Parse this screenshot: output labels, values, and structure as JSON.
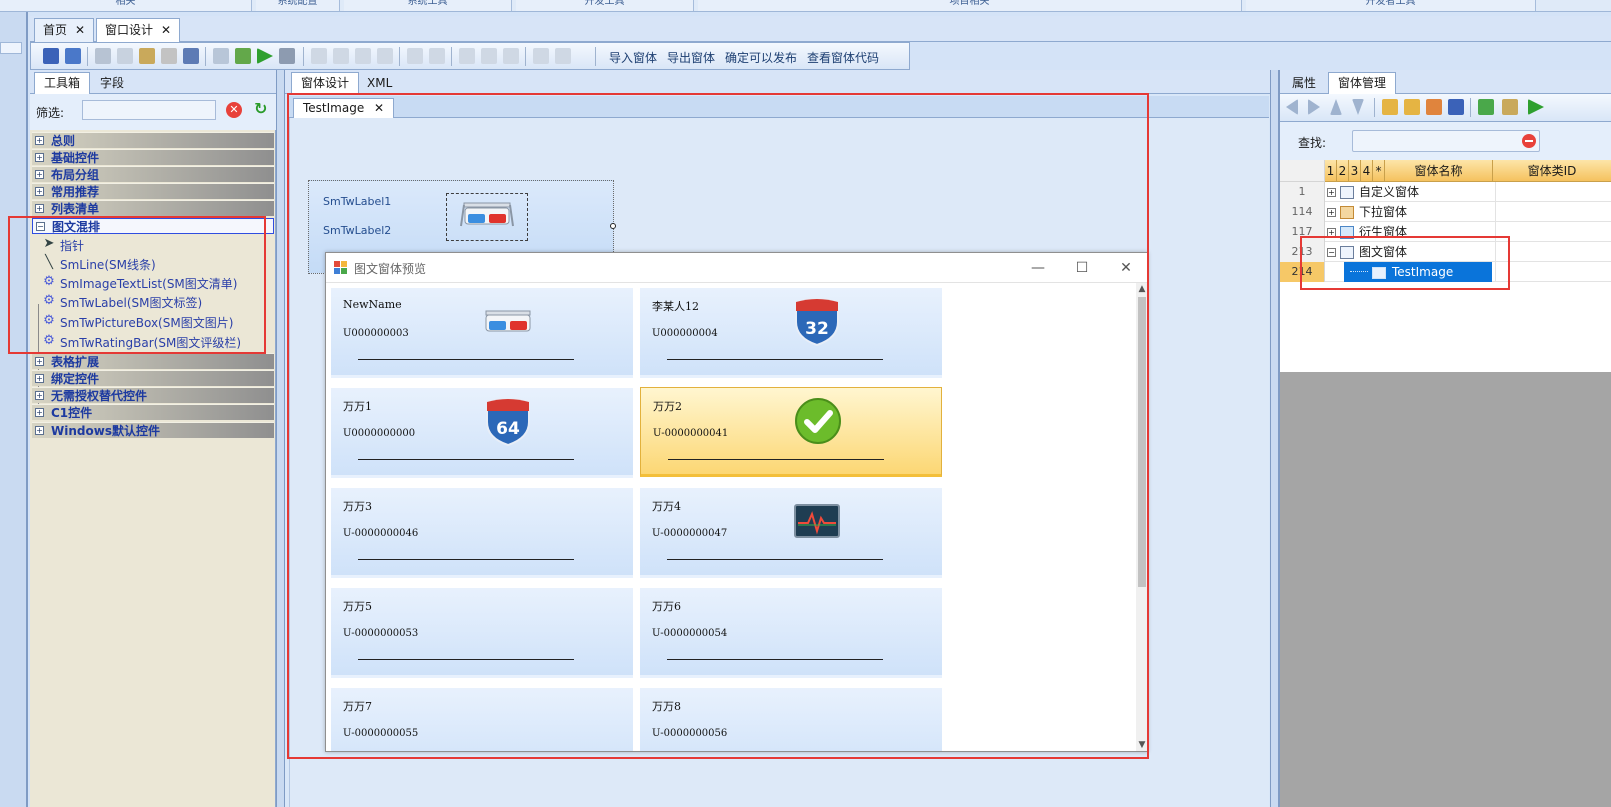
{
  "ribbon": {
    "groups": [
      "相关",
      "系统配置",
      "系统工具",
      "开发工具",
      "项目相关",
      "开发者工具"
    ]
  },
  "doc_tabs": [
    {
      "label": "首页",
      "close": "✕"
    },
    {
      "label": "窗口设计",
      "close": "✕"
    }
  ],
  "toolbar": {
    "import_label": "导入窗体",
    "export_label": "导出窗体",
    "publish_label": "确定可以发布",
    "view_code_label": "查看窗体代码"
  },
  "toolbox": {
    "tabs": [
      "工具箱",
      "字段"
    ],
    "filter_label": "筛选:",
    "filter_value": "",
    "clear_glyph": "✕",
    "refresh_glyph": "↻",
    "categories_top": [
      "总则",
      "基础控件",
      "布局分组",
      "常用推荐",
      "列表清单"
    ],
    "open_category": "图文混排",
    "items": [
      {
        "label": "指针",
        "icon": "pointer-icon",
        "glyph": "➤"
      },
      {
        "label": "SmLine(SM线条)",
        "icon": "line-icon",
        "glyph": "╲"
      },
      {
        "label": "SmImageTextList(SM图文清单)",
        "icon": "gear-icon",
        "glyph": "⚙"
      },
      {
        "label": "SmTwLabel(SM图文标签)",
        "icon": "gear-icon",
        "glyph": "⚙"
      },
      {
        "label": "SmTwPictureBox(SM图文图片)",
        "icon": "gear-icon",
        "glyph": "⚙"
      },
      {
        "label": "SmTwRatingBar(SM图文评级栏)",
        "icon": "gear-icon",
        "glyph": "⚙"
      }
    ],
    "categories_bottom": [
      "表格扩展",
      "绑定控件",
      "无需授权替代控件",
      "C1控件",
      "Windows默认控件"
    ]
  },
  "designer": {
    "tabs": [
      "窗体设计",
      "XML"
    ],
    "canvas_tab": "TestImage",
    "canvas_tab_close": "✕",
    "label1": "SmTwLabel1",
    "label2": "SmTwLabel2"
  },
  "preview": {
    "title": "图文窗体预览",
    "minimize": "—",
    "maximize": "☐",
    "close": "✕",
    "scroll_up": "▲",
    "scroll_down": "▼",
    "cards": [
      {
        "name": "NewName",
        "code": "U000000003",
        "icon": "3d-glasses-icon"
      },
      {
        "name": "李某人12",
        "code": "U000000004",
        "icon": "interstate-32-icon",
        "shield": "32"
      },
      {
        "name": "万万1",
        "code": "U0000000000",
        "icon": "interstate-64-icon",
        "shield": "64"
      },
      {
        "name": "万万2",
        "code": "U-0000000041",
        "icon": "checkmark-icon",
        "selected": true
      },
      {
        "name": "万万3",
        "code": "U-0000000046",
        "icon": ""
      },
      {
        "name": "万万4",
        "code": "U-0000000047",
        "icon": "heart-monitor-icon"
      },
      {
        "name": "万万5",
        "code": "U-0000000053",
        "icon": ""
      },
      {
        "name": "万万6",
        "code": "U-0000000054",
        "icon": ""
      },
      {
        "name": "万万7",
        "code": "U-0000000055",
        "icon": ""
      },
      {
        "name": "万万8",
        "code": "U-0000000056",
        "icon": ""
      }
    ]
  },
  "right_panel": {
    "tabs": [
      "属性",
      "窗体管理"
    ],
    "search_label": "查找:",
    "search_value": "",
    "grid_headers": [
      "1",
      "2",
      "3",
      "4",
      "*",
      "窗体名称",
      "窗体类ID"
    ],
    "rows": [
      {
        "num": "1",
        "expander": "+",
        "name": "自定义窗体"
      },
      {
        "num": "114",
        "expander": "+",
        "name": "下拉窗体"
      },
      {
        "num": "117",
        "expander": "+",
        "name": "衍生窗体"
      },
      {
        "num": "213",
        "expander": "−",
        "name": "图文窗体"
      },
      {
        "num": "214",
        "expander": "",
        "name": "TestImage",
        "selected": true
      }
    ]
  },
  "colors": {
    "accent_blue": "#0a74da",
    "highlight_red": "#e53935",
    "selected_card": "#fcd774"
  }
}
